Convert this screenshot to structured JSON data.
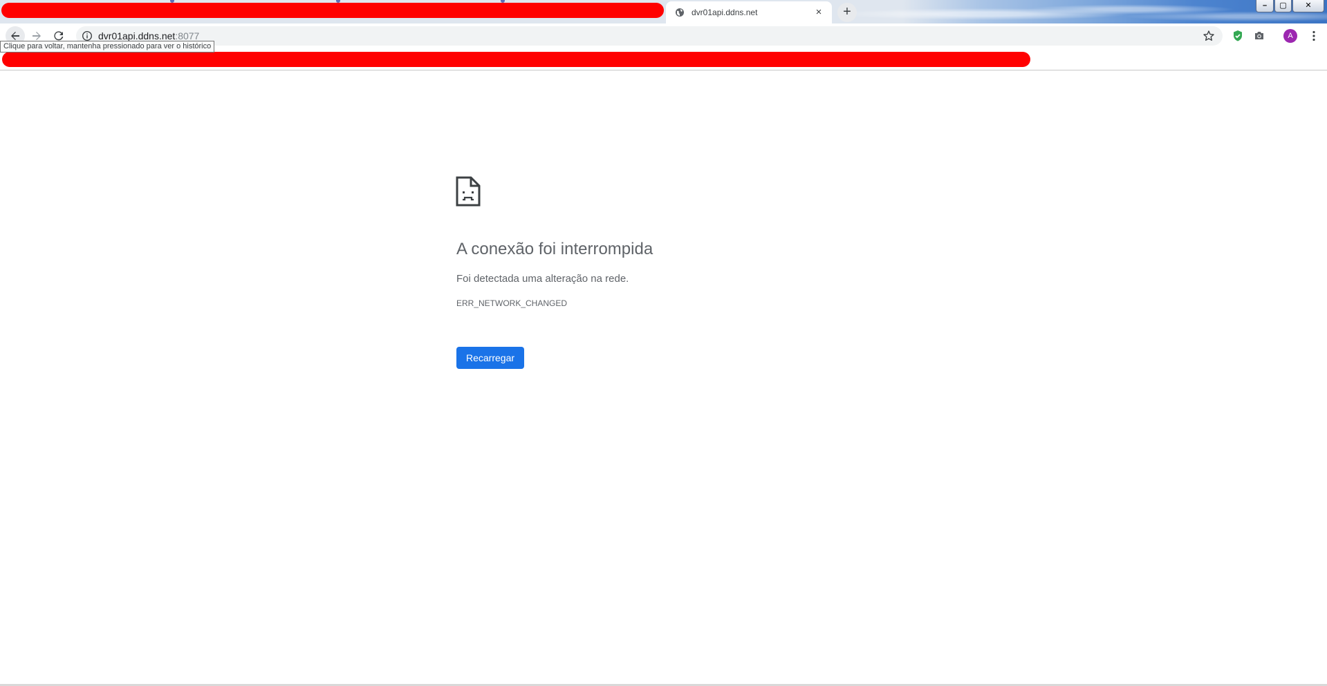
{
  "browser": {
    "active_tab": {
      "title": "dvr01api.ddns.net",
      "close_glyph": "×"
    },
    "new_tab_glyph": "+",
    "window_controls": {
      "minimize": "–",
      "maximize": "▢",
      "close": "✕"
    }
  },
  "toolbar": {
    "url_host": "dvr01api.ddns.net",
    "url_port": ":8077",
    "back_tooltip": "Clique para voltar, mantenha pressionado para ver o histórico",
    "avatar_letter": "A"
  },
  "error_page": {
    "title": "A conexão foi interrompida",
    "description": "Foi detectada uma alteração na rede.",
    "error_code": "ERR_NETWORK_CHANGED",
    "reload_label": "Recarregar"
  },
  "colors": {
    "redaction": "#ff0000",
    "accent_blue": "#1a73e8",
    "text_gray": "#5f6368",
    "shield_green": "#34a853",
    "avatar_purple": "#9c27b0"
  },
  "icons": {
    "back": "arrow-left-icon",
    "forward": "arrow-right-icon",
    "reload": "reload-icon",
    "info": "info-icon",
    "star": "star-icon",
    "shield": "shield-icon",
    "camera": "camera-icon",
    "menu": "kebab-menu-icon",
    "error": "sad-document-icon",
    "favicon": "globe-icon"
  }
}
